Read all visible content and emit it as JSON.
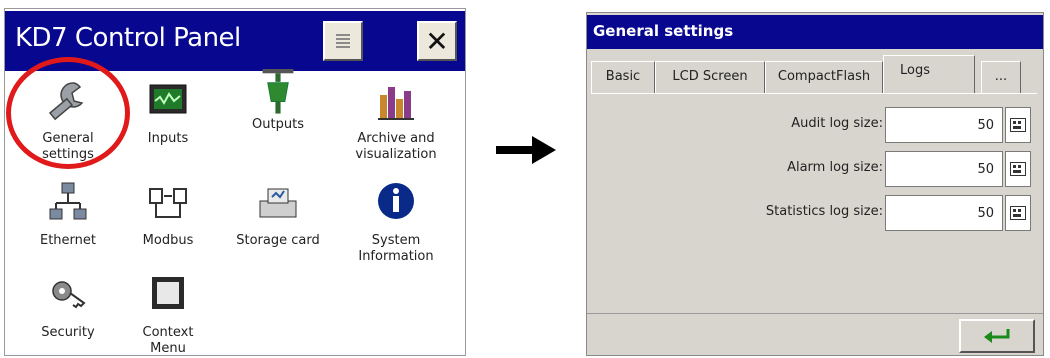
{
  "control_panel": {
    "title": "KD7 Control Panel",
    "items": [
      {
        "label": "General settings",
        "icon": "wrench-icon"
      },
      {
        "label": "Inputs",
        "icon": "monitor-waveform-icon"
      },
      {
        "label": "Outputs",
        "icon": "output-connector-icon"
      },
      {
        "label": "Archive and visualization",
        "icon": "bar-chart-icon"
      },
      {
        "label": "Ethernet",
        "icon": "network-icon"
      },
      {
        "label": "Modbus",
        "icon": "modbus-connection-icon"
      },
      {
        "label": "Storage card",
        "icon": "storage-card-icon"
      },
      {
        "label": "System Information",
        "icon": "info-icon"
      },
      {
        "label": "Security",
        "icon": "key-icon"
      },
      {
        "label": "Context Menu",
        "icon": "context-menu-icon"
      }
    ],
    "highlight_color": "#e01a1a"
  },
  "general_settings": {
    "title": "General settings",
    "tabs": [
      "Basic",
      "LCD Screen",
      "CompactFlash",
      "Logs",
      "..."
    ],
    "active_tab": "Logs",
    "fields": [
      {
        "label": "Audit log size:",
        "value": "50"
      },
      {
        "label": "Alarm log size:",
        "value": "50"
      },
      {
        "label": "Statistics log size:",
        "value": "50"
      }
    ]
  },
  "colors": {
    "title_bar": "#07078f",
    "window_bg": "#d8d5cf",
    "enter_arrow": "#1a8a1a"
  }
}
